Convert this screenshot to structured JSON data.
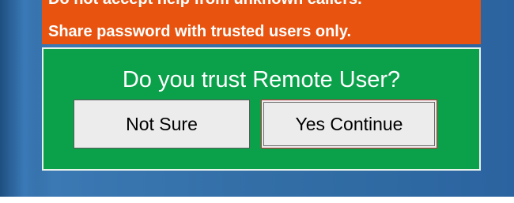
{
  "warning": {
    "line1": "Do not accept help from unknown callers.",
    "line2": "Share password with trusted users only.",
    "color": "#e8540f"
  },
  "trust_prompt": {
    "question": "Do you trust Remote User?",
    "panel_color": "#0aa14a",
    "buttons": {
      "not_sure_label": "Not Sure",
      "yes_continue_label": "Yes Continue"
    }
  }
}
